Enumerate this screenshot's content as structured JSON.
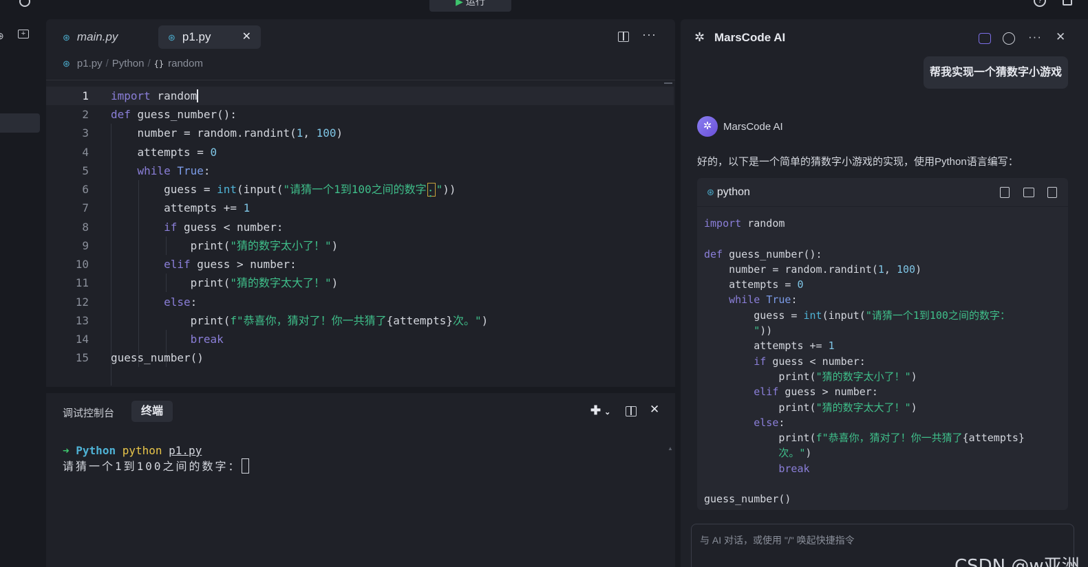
{
  "topbar": {
    "run_label": "运行"
  },
  "editor": {
    "tabs": [
      {
        "label": "main.py"
      },
      {
        "label": "p1.py"
      }
    ],
    "breadcrumb": {
      "file": "p1.py",
      "lang": "Python",
      "symbol": "random"
    },
    "line_numbers": [
      "1",
      "2",
      "3",
      "4",
      "5",
      "6",
      "7",
      "8",
      "9",
      "10",
      "11",
      "12",
      "13",
      "14",
      "15"
    ]
  },
  "panel": {
    "tabs": [
      "调试控制台",
      "终端"
    ],
    "terminal": {
      "cwd": "Python",
      "command": "python",
      "file": "p1.py",
      "prompt": "请猜一个1到100之间的数字："
    }
  },
  "ai": {
    "title": "MarsCode AI",
    "user_message": "帮我实现一个猜数字小游戏",
    "bot_name": "MarsCode AI",
    "bot_intro": "好的，以下是一个简单的猜数字小游戏的实现，使用Python语言编写：",
    "code_lang": "python",
    "input_placeholder": "与 AI 对话，或使用 \"/\" 唤起快捷指令",
    "watermark": "CSDN @w亚洲"
  },
  "colors": {
    "background": "#181a20",
    "panel": "#1f2128",
    "keyword": "#8b7fd9",
    "string": "#3fbf8a",
    "number": "#7fc6e6",
    "accent_green": "#3ec46d"
  },
  "icons": [
    "search-icon",
    "play-icon",
    "help-icon",
    "new-file-icon",
    "new-folder-icon",
    "python-file-icon",
    "close-icon",
    "split-editor-icon",
    "more-icon",
    "symbol-icon",
    "add-terminal-icon",
    "sparkle-icon",
    "new-chat-icon",
    "history-icon",
    "copy-icon",
    "insert-icon",
    "apply-icon"
  ]
}
